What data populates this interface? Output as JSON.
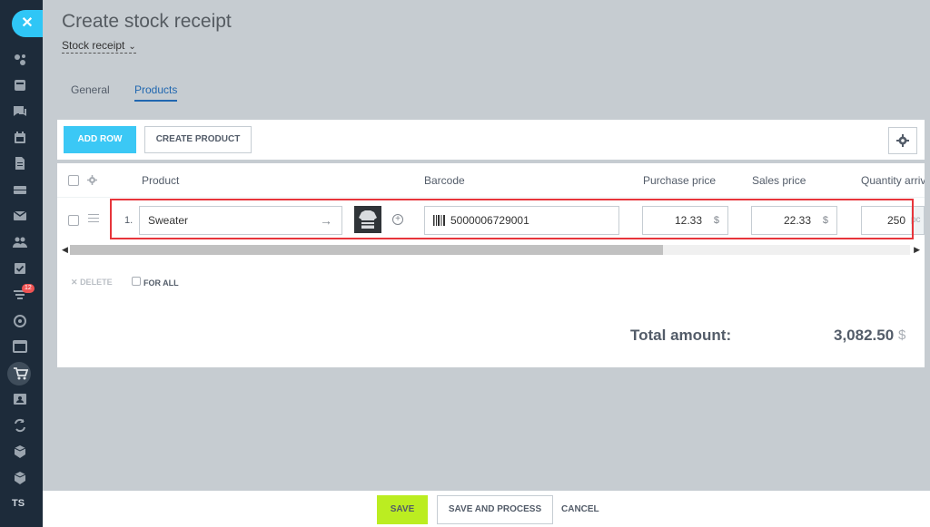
{
  "page": {
    "title": "Create stock receipt",
    "doc_type": "Stock receipt"
  },
  "tabs": [
    {
      "label": "General"
    },
    {
      "label": "Products"
    }
  ],
  "toolbar": {
    "add_row": "ADD ROW",
    "create_product": "CREATE PRODUCT"
  },
  "table": {
    "headers": {
      "product": "Product",
      "barcode": "Barcode",
      "purchase_price": "Purchase price",
      "sales_price": "Sales price",
      "quantity": "Quantity arrive"
    },
    "rows": [
      {
        "num": "1.",
        "product": "Sweater",
        "barcode": "5000006729001",
        "purchase_price": "12.33",
        "purchase_currency": "$",
        "sales_price": "22.33",
        "sales_currency": "$",
        "quantity": "250",
        "unit": "pc"
      }
    ],
    "delete_label": "DELETE",
    "for_all_label": "FOR ALL"
  },
  "totals": {
    "label": "Total amount:",
    "value": "3,082.50",
    "currency": "$"
  },
  "actions": {
    "save": "SAVE",
    "save_process": "SAVE AND PROCESS",
    "cancel": "CANCEL"
  },
  "sidebar": {
    "badge": "12",
    "user_initials": "TS"
  },
  "colors": {
    "accent": "#3bc8f5",
    "save": "#bbed21",
    "highlight": "#e7353b",
    "tab_active": "#2067b0"
  }
}
